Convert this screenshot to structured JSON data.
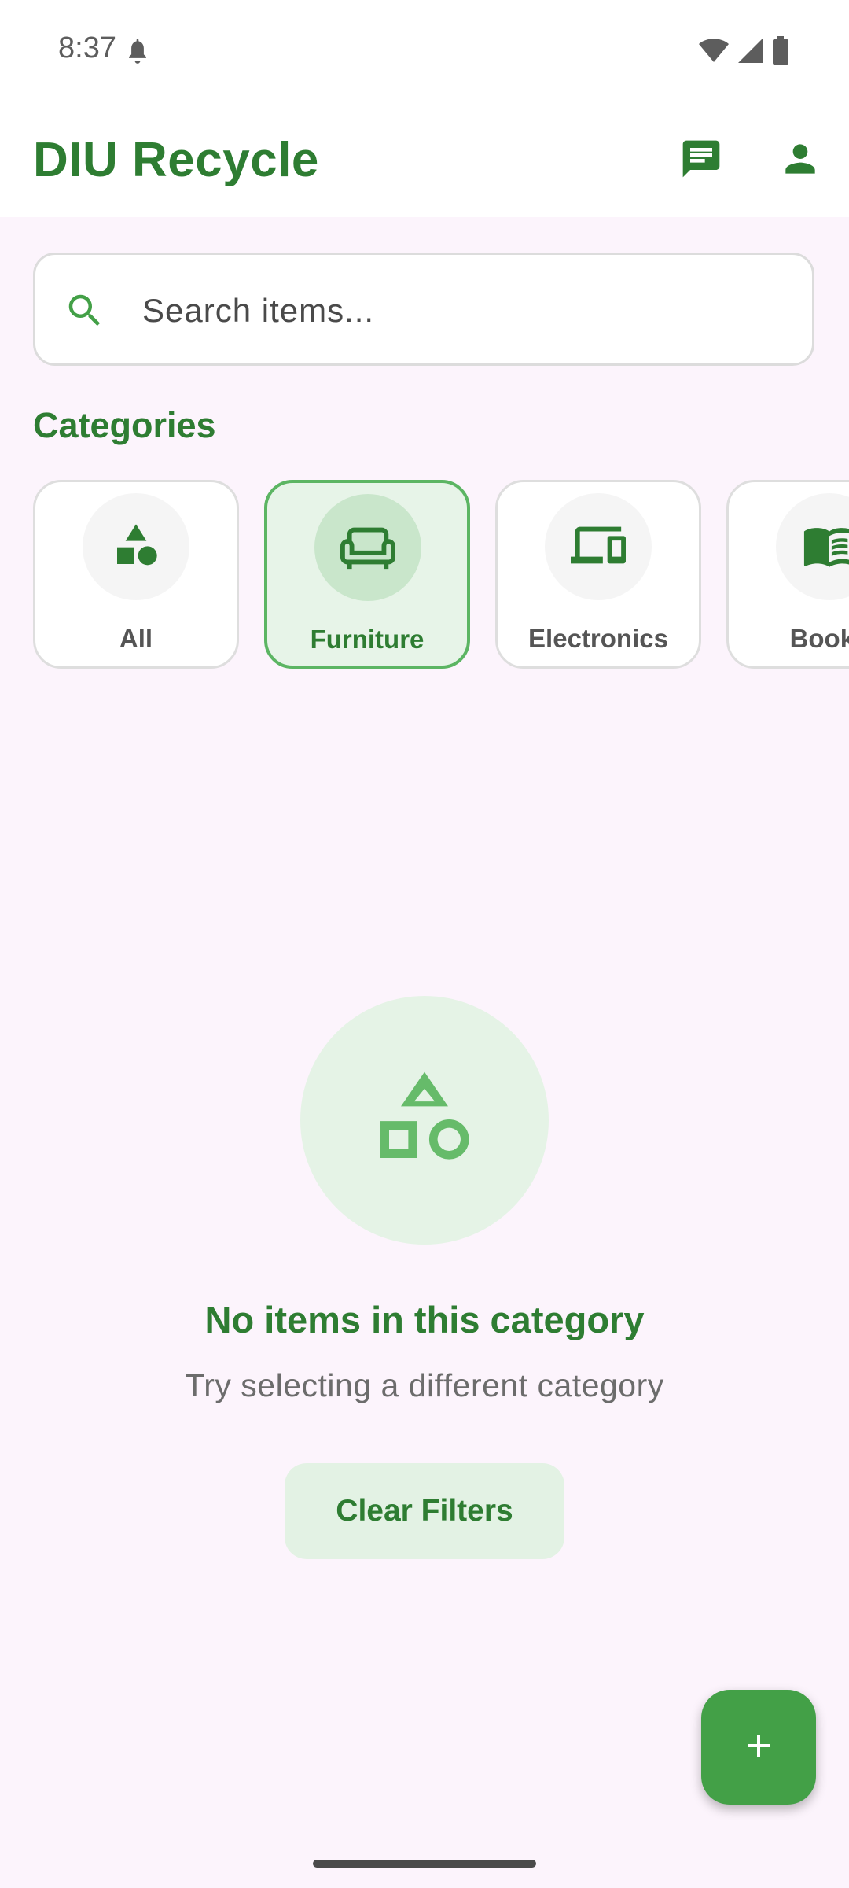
{
  "status_bar": {
    "time": "8:37",
    "icons": [
      "notification-bell-icon",
      "wifi-icon",
      "signal-icon",
      "battery-icon"
    ]
  },
  "app_bar": {
    "title": "DIU Recycle",
    "actions": [
      "chat-icon",
      "profile-icon"
    ]
  },
  "search": {
    "placeholder": "Search items...",
    "value": ""
  },
  "categories": {
    "title": "Categories",
    "items": [
      {
        "label": "All",
        "icon": "shapes-icon",
        "selected": false
      },
      {
        "label": "Furniture",
        "icon": "sofa-icon",
        "selected": true
      },
      {
        "label": "Electronics",
        "icon": "devices-icon",
        "selected": false
      },
      {
        "label": "Books",
        "icon": "book-icon",
        "selected": false
      }
    ]
  },
  "empty_state": {
    "icon": "shapes-icon",
    "title": "No items in this category",
    "subtitle": "Try selecting a different category",
    "button_label": "Clear Filters"
  },
  "fab": {
    "icon": "plus-icon"
  },
  "colors": {
    "primary": "#2e7d32",
    "fab": "#43a047",
    "selected_background": "#e7f4e8",
    "page_background": "#fcf4fc"
  }
}
